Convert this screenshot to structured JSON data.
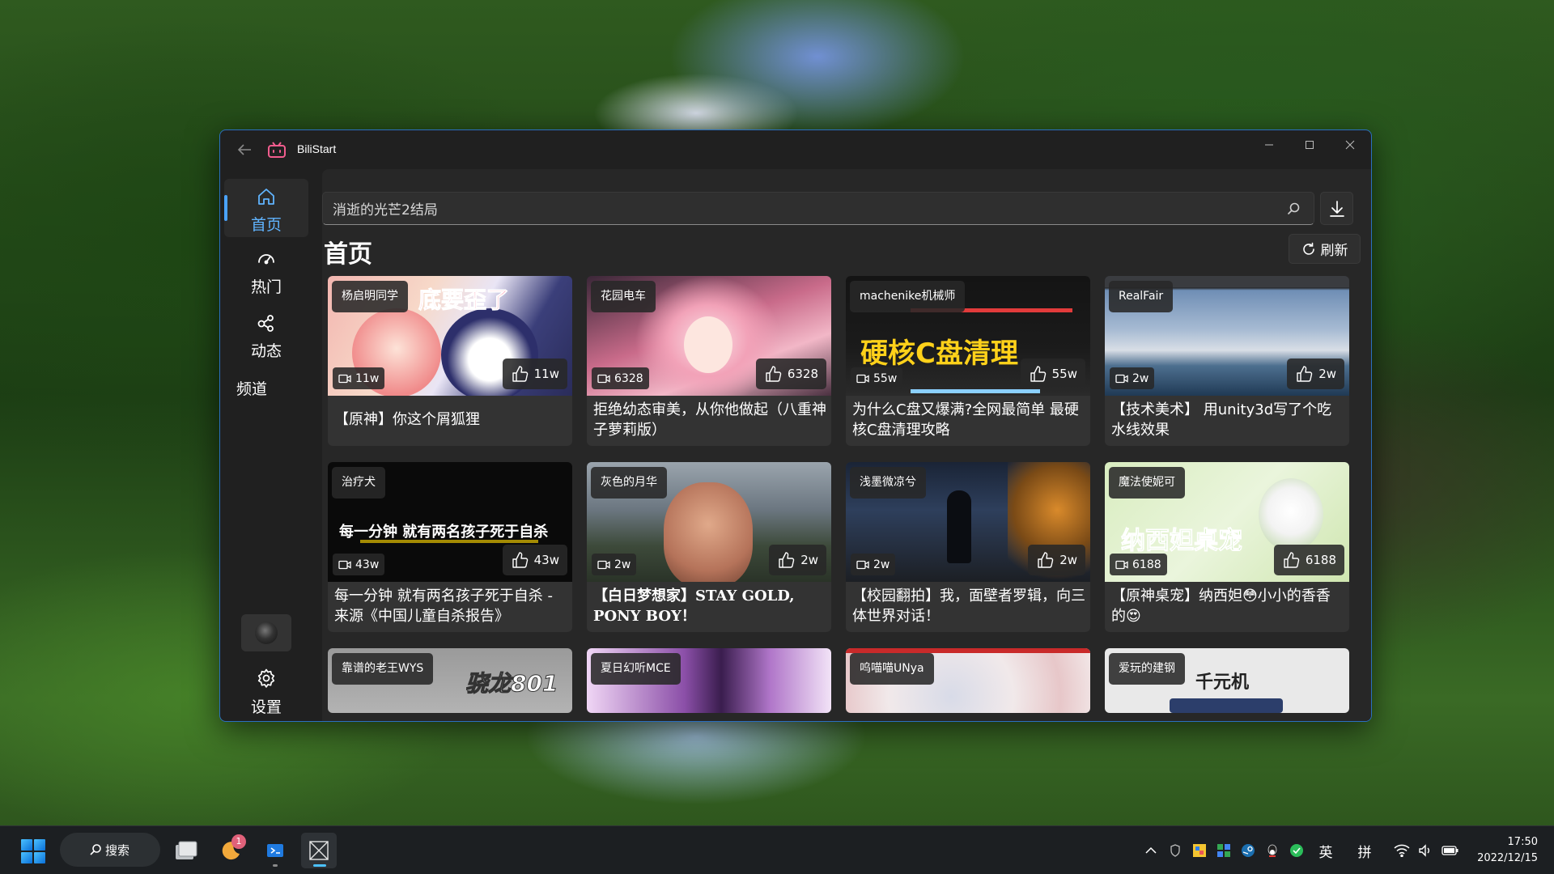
{
  "window": {
    "title": "BiliStart"
  },
  "nav": {
    "items": [
      {
        "label": "首页",
        "icon": "home-icon",
        "active": true
      },
      {
        "label": "热门",
        "icon": "trending-icon",
        "active": false
      },
      {
        "label": "动态",
        "icon": "dynamic-icon",
        "active": false
      }
    ],
    "section_label": "频道",
    "settings_label": "设置"
  },
  "search": {
    "value": "消逝的光芒2结局"
  },
  "page": {
    "title": "首页",
    "refresh_label": "刷新"
  },
  "cards": [
    {
      "uploader": "杨启明同学",
      "plays": "11w",
      "likes": "11w",
      "title": "【原神】你这个屑狐狸",
      "overlay": "底要歪了"
    },
    {
      "uploader": "花园电车",
      "plays": "6328",
      "likes": "6328",
      "title": "拒绝幼态审美，从你他做起（八重神子萝莉版）",
      "overlay": ""
    },
    {
      "uploader": "machenike机械师",
      "plays": "55w",
      "likes": "55w",
      "title": "为什么C盘又爆满?全网最简单 最硬核C盘清理攻略",
      "overlay": "硬核C盘清理"
    },
    {
      "uploader": "RealFair",
      "plays": "2w",
      "likes": "2w",
      "title": "【技术美术】 用unity3d写了个吃水线效果",
      "overlay": ""
    },
    {
      "uploader": "治疗犬",
      "plays": "43w",
      "likes": "43w",
      "title": "每一分钟 就有两名孩子死于自杀 - 来源《中国儿童自杀报告》",
      "overlay": "每一分钟 就有两名孩子死于自杀"
    },
    {
      "uploader": "灰色的月华",
      "plays": "2w",
      "likes": "2w",
      "title": "【白日梦想家】STAY GOLD, PONY BOY！",
      "overlay": ""
    },
    {
      "uploader": "浅墨微凉兮",
      "plays": "2w",
      "likes": "2w",
      "title": "【校园翻拍】我，面壁者罗辑，向三体世界对话！",
      "overlay": ""
    },
    {
      "uploader": "魔法使妮可",
      "plays": "6188",
      "likes": "6188",
      "title": "【原神桌宠】纳西妲😳小小的香香的😍",
      "overlay": "纳西妲桌宠"
    },
    {
      "uploader": "靠谱的老王WYS",
      "plays": "",
      "likes": "",
      "title": "",
      "overlay": "骁龙801"
    },
    {
      "uploader": "夏日幻听MCE",
      "plays": "",
      "likes": "",
      "title": "",
      "overlay": ""
    },
    {
      "uploader": "呜喵喵UNya",
      "plays": "",
      "likes": "",
      "title": "",
      "overlay": ""
    },
    {
      "uploader": "爱玩的建钢",
      "plays": "",
      "likes": "",
      "title": "",
      "overlay": "千元机"
    }
  ],
  "taskbar": {
    "search_label": "搜索",
    "badge_count": "1",
    "ime_lang": "英",
    "ime_mode": "拼",
    "time": "17:50",
    "date": "2022/12/15"
  }
}
